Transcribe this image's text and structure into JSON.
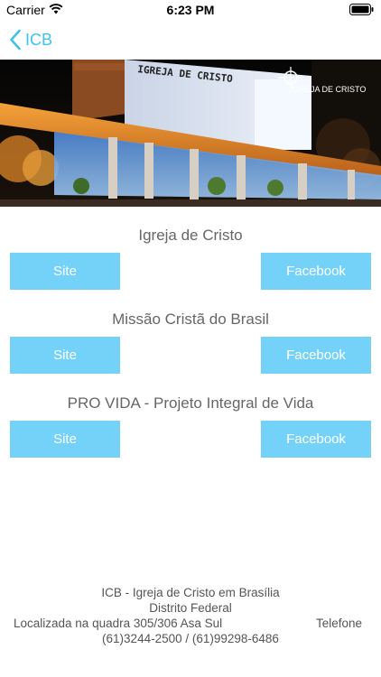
{
  "status_bar": {
    "carrier": "Carrier",
    "time": "6:23 PM"
  },
  "nav": {
    "back_label": "ICB"
  },
  "hero": {
    "building_sign": "IGREJA DE CRISTO",
    "logo_text": "IGREJA DE CRISTO"
  },
  "organizations": [
    {
      "title": "Igreja de Cristo",
      "site_label": "Site",
      "facebook_label": "Facebook"
    },
    {
      "title": "Missão Cristã do Brasil",
      "site_label": "Site",
      "facebook_label": "Facebook"
    },
    {
      "title": "PRO VIDA - Projeto Integral de Vida",
      "site_label": "Site",
      "facebook_label": "Facebook"
    }
  ],
  "footer": {
    "line1": "ICB - Igreja de Cristo em Brasília",
    "line2": "Distrito Federal",
    "address": "Localizada na quadra 305/306 Asa Sul",
    "phone_label": "Telefone",
    "phones": "(61)3244-2500 / (61)99298-6486"
  },
  "colors": {
    "accent": "#3fc2f0",
    "button_bg": "#74d2f8",
    "title_gray": "#666666"
  }
}
